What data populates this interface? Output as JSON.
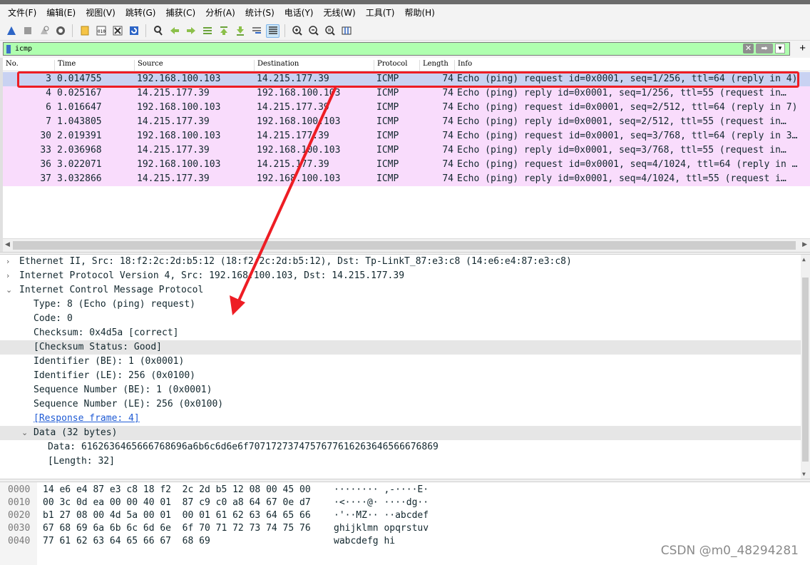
{
  "menu": [
    "文件(F)",
    "编辑(E)",
    "视图(V)",
    "跳转(G)",
    "捕获(C)",
    "分析(A)",
    "统计(S)",
    "电话(Y)",
    "无线(W)",
    "工具(T)",
    "帮助(H)"
  ],
  "filter": {
    "value": "icmp"
  },
  "columns": {
    "no": "No.",
    "time": "Time",
    "source": "Source",
    "destination": "Destination",
    "protocol": "Protocol",
    "length": "Length",
    "info": "Info"
  },
  "packets": [
    {
      "no": "3",
      "time": "0.014755",
      "src": "192.168.100.103",
      "dst": "14.215.177.39",
      "proto": "ICMP",
      "len": "74",
      "info": "Echo (ping) request  id=0x0001, seq=1/256, ttl=64 (reply in 4)"
    },
    {
      "no": "4",
      "time": "0.025167",
      "src": "14.215.177.39",
      "dst": "192.168.100.103",
      "proto": "ICMP",
      "len": "74",
      "info": "Echo (ping) reply    id=0x0001, seq=1/256, ttl=55 (request in…"
    },
    {
      "no": "6",
      "time": "1.016647",
      "src": "192.168.100.103",
      "dst": "14.215.177.39",
      "proto": "ICMP",
      "len": "74",
      "info": "Echo (ping) request  id=0x0001, seq=2/512, ttl=64 (reply in 7)"
    },
    {
      "no": "7",
      "time": "1.043805",
      "src": "14.215.177.39",
      "dst": "192.168.100.103",
      "proto": "ICMP",
      "len": "74",
      "info": "Echo (ping) reply    id=0x0001, seq=2/512, ttl=55 (request in…"
    },
    {
      "no": "30",
      "time": "2.019391",
      "src": "192.168.100.103",
      "dst": "14.215.177.39",
      "proto": "ICMP",
      "len": "74",
      "info": "Echo (ping) request  id=0x0001, seq=3/768, ttl=64 (reply in 3…"
    },
    {
      "no": "33",
      "time": "2.036968",
      "src": "14.215.177.39",
      "dst": "192.168.100.103",
      "proto": "ICMP",
      "len": "74",
      "info": "Echo (ping) reply    id=0x0001, seq=3/768, ttl=55 (request in…"
    },
    {
      "no": "36",
      "time": "3.022071",
      "src": "192.168.100.103",
      "dst": "14.215.177.39",
      "proto": "ICMP",
      "len": "74",
      "info": "Echo (ping) request  id=0x0001, seq=4/1024, ttl=64 (reply in …"
    },
    {
      "no": "37",
      "time": "3.032866",
      "src": "14.215.177.39",
      "dst": "192.168.100.103",
      "proto": "ICMP",
      "len": "74",
      "info": "Echo (ping) reply    id=0x0001, seq=4/1024, ttl=55 (request i…"
    }
  ],
  "details": [
    {
      "arrow": ">",
      "text": "Ethernet II, Src: 18:f2:2c:2d:b5:12 (18:f2:2c:2d:b5:12), Dst: Tp-LinkT_87:e3:c8 (14:e6:e4:87:e3:c8)"
    },
    {
      "arrow": ">",
      "text": "Internet Protocol Version 4, Src: 192.168.100.103, Dst: 14.215.177.39"
    },
    {
      "arrow": "v",
      "text": "Internet Control Message Protocol"
    },
    {
      "arrow": "",
      "text": "Type: 8 (Echo (ping) request)"
    },
    {
      "arrow": "",
      "text": "Code: 0"
    },
    {
      "arrow": "",
      "text": "Checksum: 0x4d5a [correct]"
    },
    {
      "arrow": "",
      "text": "[Checksum Status: Good]"
    },
    {
      "arrow": "",
      "text": "Identifier (BE): 1 (0x0001)"
    },
    {
      "arrow": "",
      "text": "Identifier (LE): 256 (0x0100)"
    },
    {
      "arrow": "",
      "text": "Sequence Number (BE): 1 (0x0001)"
    },
    {
      "arrow": "",
      "text": "Sequence Number (LE): 256 (0x0100)"
    },
    {
      "arrow": "",
      "text": "[Response frame: 4]"
    },
    {
      "arrow": "v",
      "text": "Data (32 bytes)"
    },
    {
      "arrow": "",
      "text": "Data: 6162636465666768696a6b6c6d6e6f7071727374757677616263646566676869"
    },
    {
      "arrow": "",
      "text": "[Length: 32]"
    }
  ],
  "bytes": [
    {
      "off": "0000",
      "hex": "14 e6 e4 87 e3 c8 18 f2  2c 2d b5 12 08 00 45 00",
      "ascii": "········ ,-····E·"
    },
    {
      "off": "0010",
      "hex": "00 3c 0d ea 00 00 40 01  87 c9 c0 a8 64 67 0e d7",
      "ascii": "·<····@· ····dg··"
    },
    {
      "off": "0020",
      "hex": "b1 27 08 00 4d 5a 00 01  00 01 61 62 63 64 65 66",
      "ascii": "·'··MZ·· ··abcdef"
    },
    {
      "off": "0030",
      "hex": "67 68 69 6a 6b 6c 6d 6e  6f 70 71 72 73 74 75 76",
      "ascii": "ghijklmn opqrstuv"
    },
    {
      "off": "0040",
      "hex": "77 61 62 63 64 65 66 67  68 69",
      "ascii": "wabcdefg hi"
    }
  ],
  "watermark": "CSDN @m0_48294281",
  "colors": {
    "row": "#f9dcfc",
    "selected_row": "#c9d2f2",
    "filter_ok": "#afffaf",
    "annotation": "#ee1d24",
    "link": "#1f5bd5"
  }
}
